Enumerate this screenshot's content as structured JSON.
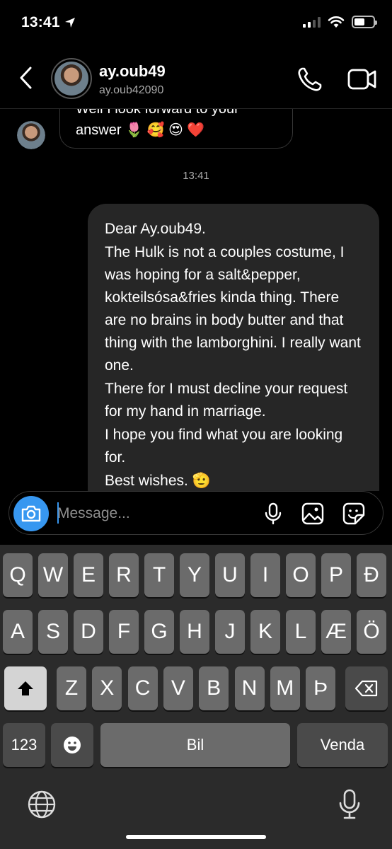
{
  "status": {
    "time": "13:41"
  },
  "header": {
    "name": "ay.oub49",
    "username": "ay.oub42090"
  },
  "chat": {
    "received_partial_line": "Well I look forward to your",
    "received_line": "answer 🌷 🥰 😍 ❤️",
    "timestamp": "13:41",
    "sent_lines": [
      "Dear Ay.oub49.",
      "The Hulk is not a couples costume, I was hoping for a salt&pepper, kokteilsósa&fries kinda thing. There are no brains in body butter and that thing with the lamborghini. I really want one.",
      "There for I must decline your request for my hand in marriage.",
      "I hope you find what you are looking for.",
      "Best wishes. 🫡"
    ]
  },
  "composer": {
    "placeholder": "Message..."
  },
  "keyboard": {
    "row1": [
      "Q",
      "W",
      "E",
      "R",
      "T",
      "Y",
      "U",
      "I",
      "O",
      "P",
      "Đ"
    ],
    "row2": [
      "A",
      "S",
      "D",
      "F",
      "G",
      "H",
      "J",
      "K",
      "L",
      "Æ",
      "Ö"
    ],
    "row3": [
      "Z",
      "X",
      "C",
      "V",
      "B",
      "N",
      "M",
      "Þ"
    ],
    "numbers_label": "123",
    "space_label": "Bil",
    "return_label": "Venda"
  },
  "colors": {
    "accent": "#3797f0",
    "bubble": "#262626",
    "keyboard_bg": "#2b2b2b",
    "key": "#6b6b6b"
  },
  "icons": [
    "location-arrow-icon",
    "cellular-signal-icon",
    "wifi-icon",
    "battery-icon",
    "back-chevron-icon",
    "phone-icon",
    "video-camera-icon",
    "camera-icon",
    "microphone-icon",
    "gallery-icon",
    "sticker-icon",
    "shift-icon",
    "backspace-icon",
    "emoji-icon",
    "globe-icon",
    "dictation-mic-icon"
  ]
}
